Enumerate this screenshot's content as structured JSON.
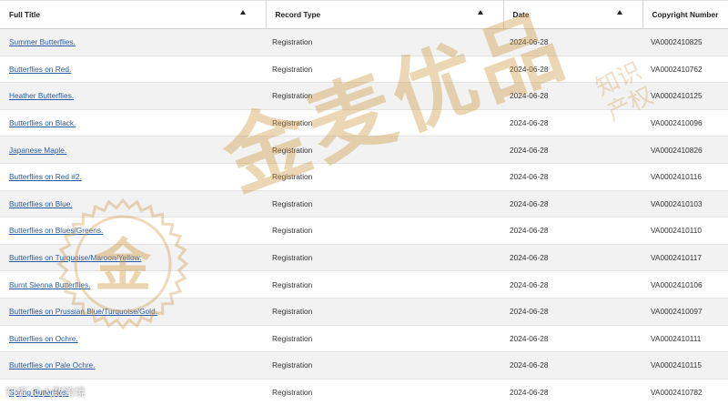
{
  "table": {
    "headers": [
      {
        "label": "Full Title",
        "sortable": true
      },
      {
        "label": "Record Type",
        "sortable": true
      },
      {
        "label": "Date",
        "sortable": true
      },
      {
        "label": "Copyright Number",
        "sortable": false
      }
    ],
    "rows": [
      {
        "title": "Summer Butterflies.",
        "type": "Registration",
        "date": "2024-06-28",
        "number": "VA0002410825"
      },
      {
        "title": "Butterflies on Red.",
        "type": "Registration",
        "date": "2024-06-28",
        "number": "VA0002410762"
      },
      {
        "title": "Heather Butterflies.",
        "type": "Registration",
        "date": "2024-06-28",
        "number": "VA0002410125"
      },
      {
        "title": "Butterflies on Black.",
        "type": "Registration",
        "date": "2024-06-28",
        "number": "VA0002410096"
      },
      {
        "title": "Japanese Maple.",
        "type": "Registration",
        "date": "2024-06-28",
        "number": "VA0002410826"
      },
      {
        "title": "Butterflies on Red #2.",
        "type": "Registration",
        "date": "2024-06-28",
        "number": "VA0002410116"
      },
      {
        "title": "Butterflies on Blue.",
        "type": "Registration",
        "date": "2024-06-28",
        "number": "VA0002410103"
      },
      {
        "title": "Butterflies on Blues/Greens.",
        "type": "Registration",
        "date": "2024-06-28",
        "number": "VA0002410110"
      },
      {
        "title": "Butterflies on Turquoise/Maroon/Yellow.",
        "type": "Registration",
        "date": "2024-06-28",
        "number": "VA0002410117"
      },
      {
        "title": "Burnt Sienna Butterflies.",
        "type": "Registration",
        "date": "2024-06-28",
        "number": "VA0002410106"
      },
      {
        "title": "Butterflies on Prussian Blue/Turquoise/Gold.",
        "type": "Registration",
        "date": "2024-06-28",
        "number": "VA0002410097"
      },
      {
        "title": "Butterflies on Ochre.",
        "type": "Registration",
        "date": "2024-06-28",
        "number": "VA0002410111"
      },
      {
        "title": "Butterflies on Pale Ochre.",
        "type": "Registration",
        "date": "2024-06-28",
        "number": "VA0002410115"
      },
      {
        "title": "Spring Butterflies.",
        "type": "Registration",
        "date": "2024-06-28",
        "number": "VA0002410782"
      }
    ]
  },
  "watermark": {
    "main_text": "金麦优品",
    "seal_char": "金",
    "small_text": [
      "知识",
      "产权"
    ],
    "footer_text": "知乎 @大数跨境"
  },
  "colors": {
    "link": "#2a5aa0",
    "row_stripe": "#f2f2f2",
    "watermark": "#cd963c"
  }
}
